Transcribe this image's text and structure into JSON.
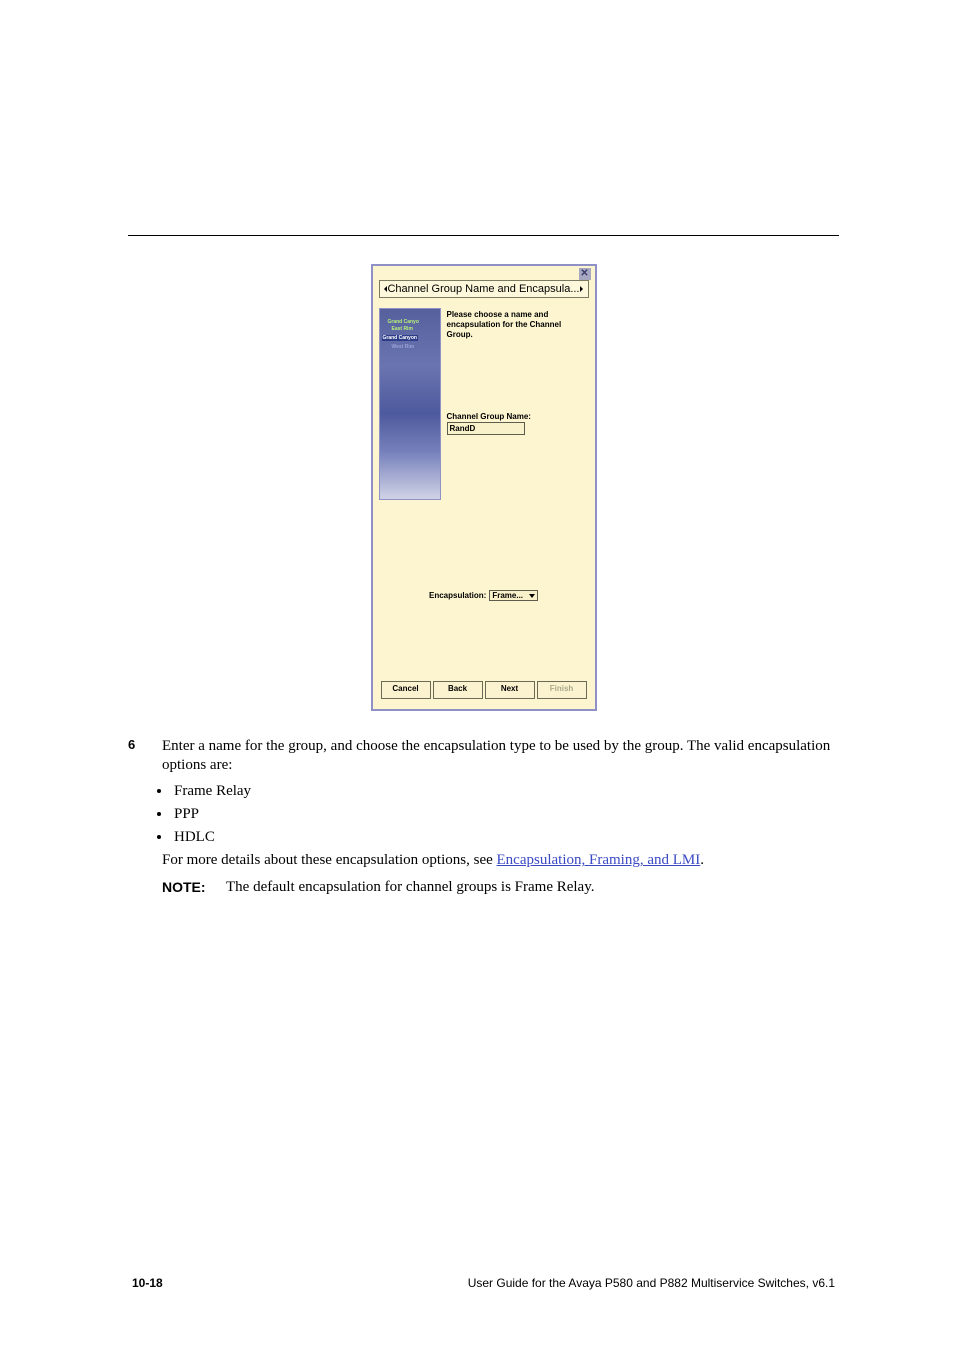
{
  "dialog": {
    "title": "Channel Group Name and Encapsula...",
    "prompt": "Please choose a name and encapsulation for the Channel Group.",
    "cg_name_label": "Channel Group Name:",
    "cg_name_value": "RandD",
    "encap_label": "Encapsulation:",
    "encap_value": "Frame...",
    "side_labels": [
      "Grand Canyo",
      "East Rim",
      "Grand Canyon",
      "West Rim"
    ],
    "buttons": {
      "cancel": "Cancel",
      "back": "Back",
      "next": "Next",
      "finish": "Finish"
    },
    "close_glyph": "✕"
  },
  "step6": {
    "num": "6",
    "text": "Enter a name for the group, and choose the encapsulation type to be used by the group. The valid encapsulation options are:"
  },
  "encaps": [
    "Frame Relay",
    "PPP",
    "HDLC"
  ],
  "xref_lead": "For more details about these encapsulation options, see ",
  "xref_link": "Encapsulation, Framing, and LMI",
  "xref_tail": ".",
  "note": {
    "label": "NOTE:",
    "text": "The default encapsulation for channel groups is Frame Relay."
  },
  "footer": {
    "page": "10-18",
    "book": "User Guide for the Avaya P580 and P882 Multiservice Switches, v6.1"
  }
}
